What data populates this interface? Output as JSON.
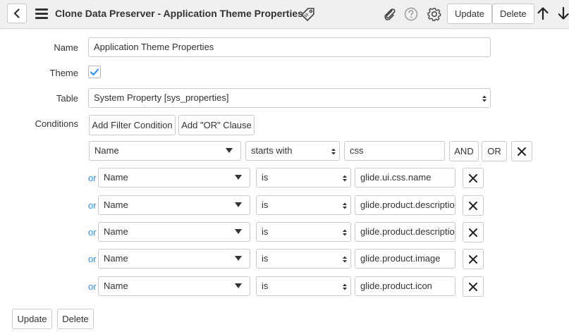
{
  "header": {
    "title": "Clone Data Preserver - Application Theme Properties",
    "update_label": "Update",
    "delete_label": "Delete"
  },
  "form": {
    "name_label": "Name",
    "name_value": "Application Theme Properties",
    "theme_label": "Theme",
    "theme_checked": true,
    "table_label": "Table",
    "table_value": "System Property [sys_properties]",
    "conditions_label": "Conditions",
    "add_filter_label": "Add Filter Condition",
    "add_or_label": "Add \"OR\" Clause"
  },
  "conditions": {
    "first": {
      "field": "Name",
      "operator": "starts with",
      "value": "css",
      "and_label": "AND",
      "or_label": "OR"
    },
    "or_rows": [
      {
        "prefix": "or",
        "field": "Name",
        "operator": "is",
        "value": "glide.ui.css.name"
      },
      {
        "prefix": "or",
        "field": "Name",
        "operator": "is",
        "value": "glide.product.description"
      },
      {
        "prefix": "or",
        "field": "Name",
        "operator": "is",
        "value": "glide.product.description"
      },
      {
        "prefix": "or",
        "field": "Name",
        "operator": "is",
        "value": "glide.product.image"
      },
      {
        "prefix": "or",
        "field": "Name",
        "operator": "is",
        "value": "glide.product.icon"
      }
    ]
  },
  "footer": {
    "update_label": "Update",
    "delete_label": "Delete"
  },
  "colors": {
    "or_link": "#278efc",
    "check": "#278efc",
    "header_bg": "#f0f0f0"
  }
}
